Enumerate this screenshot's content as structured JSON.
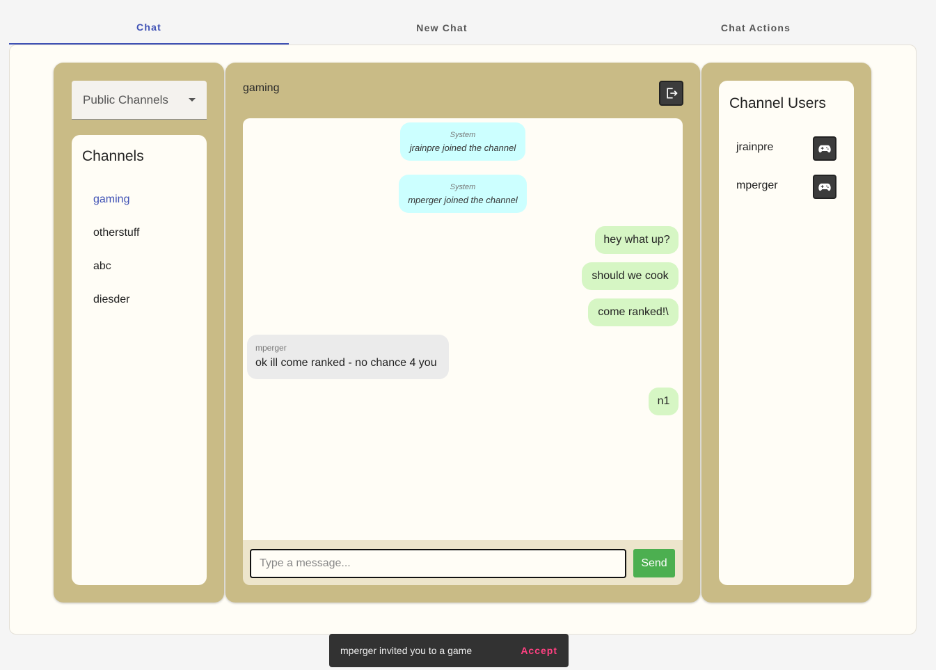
{
  "tabs": [
    {
      "label": "Chat",
      "active": true
    },
    {
      "label": "New Chat",
      "active": false
    },
    {
      "label": "Chat Actions",
      "active": false
    }
  ],
  "channel_selector": {
    "value": "Public Channels"
  },
  "channels": {
    "title": "Channels",
    "items": [
      {
        "label": "gaming",
        "active": true
      },
      {
        "label": "otherstuff",
        "active": false
      },
      {
        "label": "abc",
        "active": false
      },
      {
        "label": "diesder",
        "active": false
      }
    ]
  },
  "chat": {
    "channel_name": "gaming",
    "leave_icon": "logout-icon",
    "messages": [
      {
        "type": "system",
        "author": "System",
        "text": "jrainpre joined the channel"
      },
      {
        "type": "system",
        "author": "System",
        "text": "mperger joined the channel"
      },
      {
        "type": "mine",
        "text": "hey what up?"
      },
      {
        "type": "mine",
        "text": "should we cook"
      },
      {
        "type": "mine",
        "text": "come ranked!\\"
      },
      {
        "type": "theirs",
        "author": "mperger",
        "text": "ok ill come ranked - no chance 4 you"
      },
      {
        "type": "mine",
        "text": "n1"
      }
    ],
    "input_placeholder": "Type a message...",
    "send_label": "Send"
  },
  "users": {
    "title": "Channel Users",
    "items": [
      {
        "name": "jrainpre",
        "icon": "gamepad-icon"
      },
      {
        "name": "mperger",
        "icon": "gamepad-icon"
      }
    ]
  },
  "snackbar": {
    "text": "mperger invited you to a game",
    "action": "Accept"
  },
  "colors": {
    "accent": "#3f51b5",
    "panel_tan": "#c9bb86",
    "system_bubble": "#ccffff",
    "own_bubble": "#d6f6c4",
    "other_bubble": "#ebebeb",
    "send_button": "#4caf50",
    "snackbar_action": "#ff4081"
  }
}
